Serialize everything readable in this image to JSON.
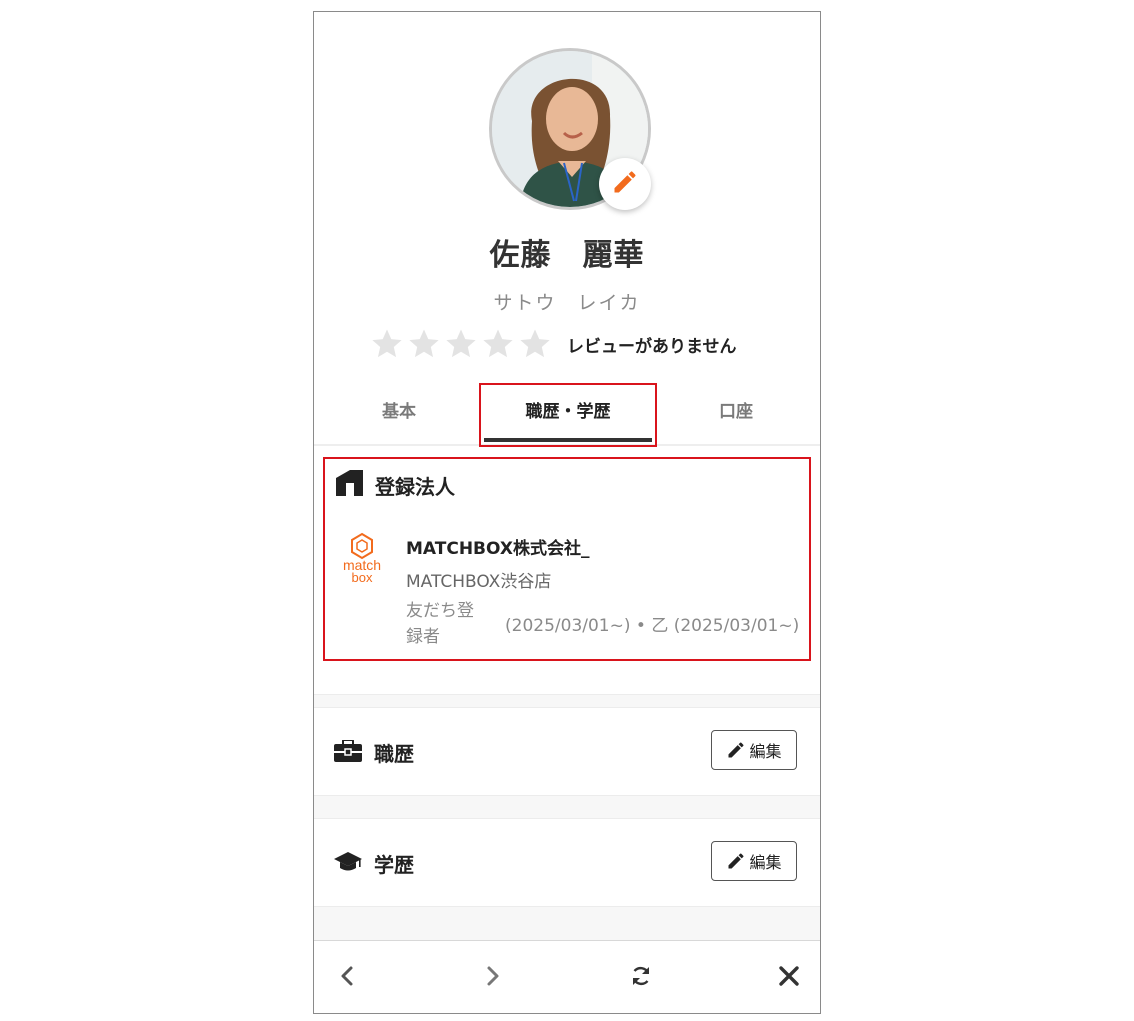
{
  "profile": {
    "name": "佐藤　麗華",
    "kana": "サトウ　レイカ",
    "rating_text": "レビューがありません",
    "star_count": 5,
    "filled_stars": 0
  },
  "tabs": [
    {
      "label": "基本",
      "active": false
    },
    {
      "label": "職歴・学歴",
      "active": true
    },
    {
      "label": "口座",
      "active": false
    }
  ],
  "registered_corp": {
    "section_label": "登録法人",
    "icon": "building-icon",
    "logo_text_1": "match",
    "logo_text_2": "box",
    "company": "MATCHBOX株式会社_",
    "store": "MATCHBOX渋谷店",
    "role": "友だち登録者",
    "dates": "(2025/03/01~) • 乙 (2025/03/01~)"
  },
  "work_history": {
    "label": "職歴",
    "icon": "briefcase-icon",
    "edit_label": "編集"
  },
  "education": {
    "label": "学歴",
    "icon": "graduation-cap-icon",
    "edit_label": "編集"
  },
  "bottom_nav": [
    "back-icon",
    "forward-icon",
    "refresh-icon",
    "close-icon"
  ],
  "colors": {
    "accent": "#f26b1d",
    "highlight": "#d9141c",
    "star": "#e3e3e3"
  }
}
